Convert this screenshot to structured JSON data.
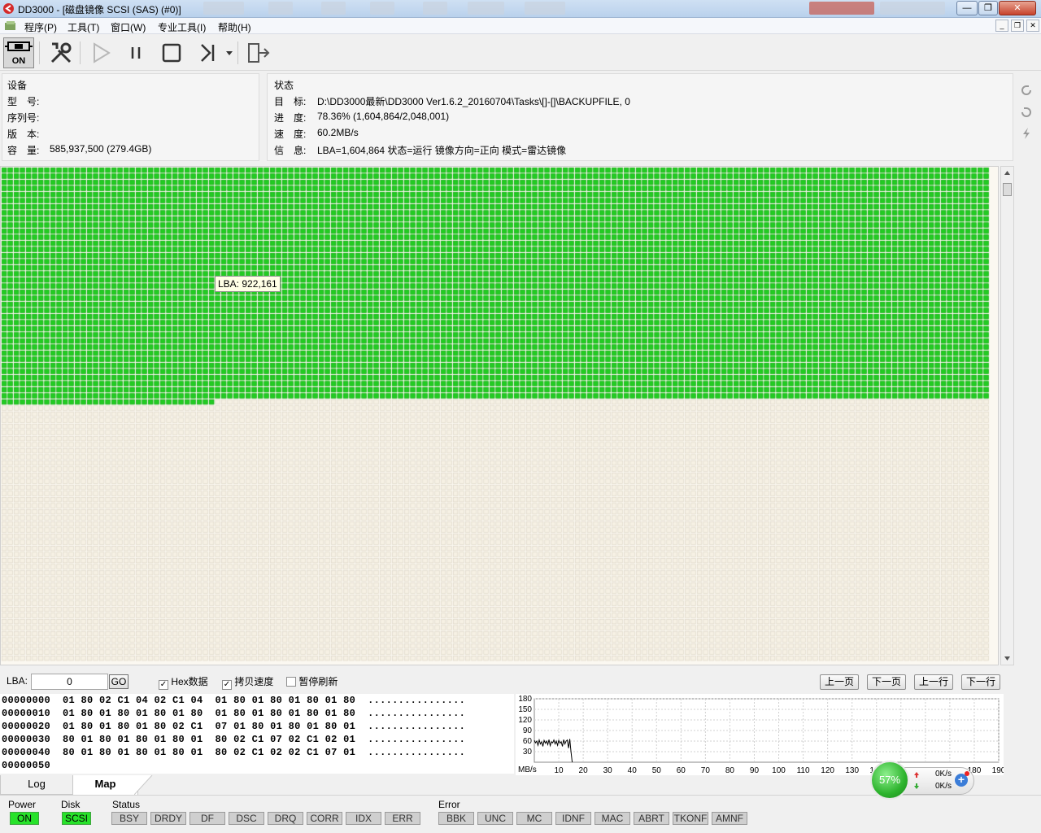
{
  "window": {
    "title": "DD3000 - [磁盘镜像 SCSI (SAS) (#0)]",
    "minimize_glyph": "—",
    "maximize_glyph": "❐",
    "close_glyph": "✕"
  },
  "menu": {
    "items": [
      "程序(P)",
      "工具(T)",
      "窗口(W)",
      "专业工具(I)",
      "帮助(H)"
    ],
    "mdi_buttons": [
      "_",
      "❐",
      "✕"
    ]
  },
  "toolbar": {
    "power_label": "ON"
  },
  "device": {
    "header": "设备",
    "model_label": "型　号:",
    "model_value": "",
    "serial_label": "序列号:",
    "serial_value": "",
    "version_label": "版　本:",
    "version_value": "",
    "capacity_label": "容　量:",
    "capacity_value": "585,937,500 (279.4GB)"
  },
  "status": {
    "header": "状态",
    "target_label": "目　标:",
    "target_value": "D:\\DD3000最新\\DD3000 Ver1.6.2_20160704\\Tasks\\[]-[]\\BACKUPFILE, 0",
    "progress_label": "进　度:",
    "progress_value": "78.36%  (1,604,864/2,048,001)",
    "speed_label": "速　度:",
    "speed_value": "60.2MB/s",
    "info_label": "信　息:",
    "info_value": "LBA=1,604,864  状态=运行  镜像方向=正向  模式=雷达镜像"
  },
  "map": {
    "tooltip": "LBA: 922,161",
    "done_fraction": 0.7836,
    "done_color": "#22cc22",
    "pending_color": "#f6f1e4"
  },
  "controls": {
    "lba_label": "LBA:",
    "lba_value": "0",
    "go_label": "GO",
    "hex_label": "Hex数据",
    "hex_checked": true,
    "copyspeed_label": "拷贝速度",
    "copyspeed_checked": true,
    "pause_refresh_label": "暂停刷新",
    "pause_refresh_checked": false,
    "prev_page": "上一页",
    "next_page": "下一页",
    "prev_line": "上一行",
    "next_line": "下一行"
  },
  "hex": {
    "rows": [
      {
        "addr": "00000000",
        "bytes": "01 80 02 C1 04 02 C1 04  01 80 01 80 01 80 01 80",
        "ascii": "................"
      },
      {
        "addr": "00000010",
        "bytes": "01 80 01 80 01 80 01 80  01 80 01 80 01 80 01 80",
        "ascii": "................"
      },
      {
        "addr": "00000020",
        "bytes": "01 80 01 80 01 80 02 C1  07 01 80 01 80 01 80 01",
        "ascii": "................"
      },
      {
        "addr": "00000030",
        "bytes": "80 01 80 01 80 01 80 01  80 02 C1 07 02 C1 02 01",
        "ascii": "................"
      },
      {
        "addr": "00000040",
        "bytes": "80 01 80 01 80 01 80 01  80 02 C1 02 02 C1 07 01",
        "ascii": "................"
      },
      {
        "addr": "00000050",
        "bytes": "",
        "ascii": ""
      }
    ]
  },
  "chart_data": {
    "type": "line",
    "title": "",
    "xlabel": "",
    "ylabel": "MB/s",
    "xlim": [
      0,
      190
    ],
    "ylim": [
      0,
      180
    ],
    "x_ticks": [
      10,
      20,
      30,
      40,
      50,
      60,
      70,
      80,
      90,
      100,
      110,
      120,
      130,
      140,
      150,
      160,
      170,
      180,
      190
    ],
    "y_ticks": [
      30,
      60,
      90,
      120,
      150,
      180
    ],
    "grid": true,
    "series": [
      {
        "x": [
          0,
          0.5,
          1,
          1.5,
          2,
          2.5,
          3,
          3.5,
          4,
          4.5,
          5,
          5.5,
          6,
          6.5,
          7,
          7.5,
          8,
          8.5,
          9,
          9.5,
          10,
          10.5,
          11,
          11.5,
          12,
          12.5,
          13,
          13.5,
          14,
          14.5,
          15,
          15.5
        ],
        "y": [
          62,
          55,
          60,
          48,
          63,
          52,
          58,
          45,
          62,
          54,
          60,
          50,
          64,
          47,
          58,
          55,
          63,
          52,
          60,
          48,
          62,
          54,
          58,
          45,
          64,
          52,
          60,
          63,
          40,
          66,
          30,
          0
        ]
      }
    ]
  },
  "tabs": [
    "Log",
    "Map"
  ],
  "statusbar": {
    "power": {
      "label": "Power",
      "leds": [
        {
          "text": "ON",
          "on": true
        }
      ]
    },
    "disk": {
      "label": "Disk",
      "leds": [
        {
          "text": "SCSI",
          "on": true
        }
      ]
    },
    "status": {
      "label": "Status",
      "leds": [
        {
          "text": "BSY",
          "on": false
        },
        {
          "text": "DRDY",
          "on": false
        },
        {
          "text": "DF",
          "on": false
        },
        {
          "text": "DSC",
          "on": false
        },
        {
          "text": "DRQ",
          "on": false
        },
        {
          "text": "CORR",
          "on": false
        },
        {
          "text": "IDX",
          "on": false
        },
        {
          "text": "ERR",
          "on": false
        }
      ]
    },
    "error": {
      "label": "Error",
      "leds": [
        {
          "text": "BBK",
          "on": false
        },
        {
          "text": "UNC",
          "on": false
        },
        {
          "text": "MC",
          "on": false
        },
        {
          "text": "IDNF",
          "on": false
        },
        {
          "text": "MAC",
          "on": false
        },
        {
          "text": "ABRT",
          "on": false
        },
        {
          "text": "TKONF",
          "on": false
        },
        {
          "text": "AMNF",
          "on": false
        }
      ]
    }
  },
  "netwidget": {
    "percent": "57%",
    "up_rate": "0K/s",
    "down_rate": "0K/s"
  }
}
